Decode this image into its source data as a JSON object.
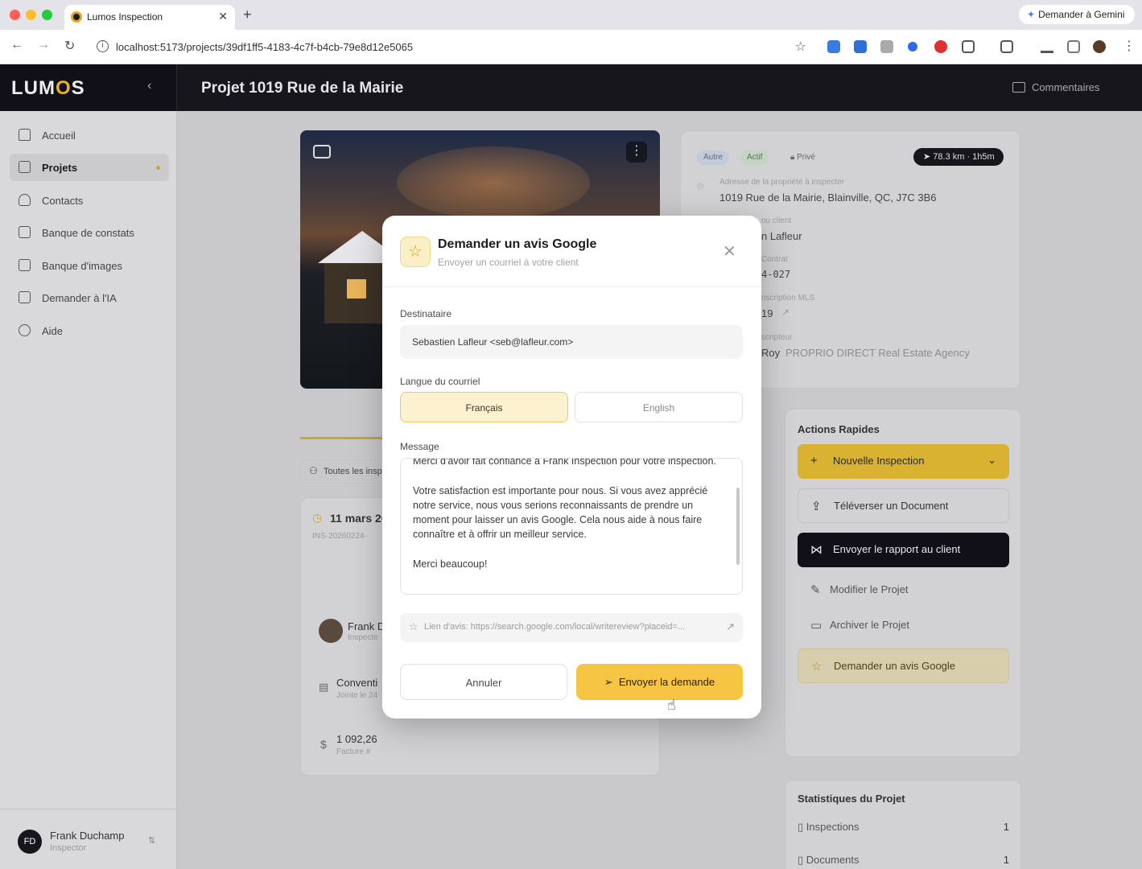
{
  "browser": {
    "tab_title": "Lumos Inspection",
    "url": "localhost:5173/projects/39df1ff5-4183-4c7f-b4cb-79e8d12e5065",
    "gemini_label": "Demander à Gemini"
  },
  "app": {
    "logo": "LUMOS",
    "project_title": "Projet 1019 Rue de la Mairie",
    "comments_label": "Commentaires"
  },
  "sidebar": {
    "items": [
      {
        "label": "Accueil",
        "icon": "home-icon"
      },
      {
        "label": "Projets",
        "icon": "folder-icon",
        "active": true
      },
      {
        "label": "Contacts",
        "icon": "user-icon"
      },
      {
        "label": "Banque de constats",
        "icon": "document-icon"
      },
      {
        "label": "Banque d'images",
        "icon": "image-icon"
      },
      {
        "label": "Demander à l'IA",
        "icon": "chat-icon"
      },
      {
        "label": "Aide",
        "icon": "help-icon"
      }
    ],
    "user": {
      "initials": "FD",
      "name": "Frank Duchamp",
      "role": "Inspector"
    }
  },
  "project_info": {
    "badges": [
      "Autre",
      "Actif",
      "Privé"
    ],
    "distance": "78.3 km · 1h5m",
    "address_label": "Adresse de la propriété à inspecter",
    "address": "1019 Rue de la Mairie, Blainville, QC, J7C 3B6",
    "client_label": "ou client",
    "client": "n Lafleur",
    "contract_label": "Contrat",
    "contract": "4-027",
    "mls_label": "nscription MLS",
    "mls": "19",
    "broker_label": "scripteur",
    "broker_name": "Roy",
    "broker_agency": "PROPRIO DIRECT Real Estate Agency"
  },
  "inspections": {
    "filter": "Toutes les insp",
    "date": "11 mars 20",
    "id": "INS-20260224-",
    "inspector": "Frank D",
    "inspector_role": "Inspecte",
    "doc_title": "Conventi",
    "doc_sub": "Jointe le 24",
    "amount": "1 092,26",
    "amount_sub": "Facture #"
  },
  "quick_actions": {
    "title": "Actions Rapides",
    "items": [
      "Nouvelle Inspection",
      "Téléverser un Document",
      "Envoyer le rapport au client",
      "Modifier le Projet",
      "Archiver le Projet",
      "Demander un avis Google"
    ]
  },
  "stats": {
    "title": "Statistiques du Projet",
    "rows": [
      {
        "label": "Inspections",
        "value": "1"
      },
      {
        "label": "Documents",
        "value": "1"
      }
    ]
  },
  "modal": {
    "title": "Demander un avis Google",
    "subtitle": "Envoyer un courriel à votre client",
    "recipient_label": "Destinataire",
    "recipient": "Sebastien Lafleur <seb@lafleur.com>",
    "language_label": "Langue du courriel",
    "lang_fr": "Français",
    "lang_en": "English",
    "message_label": "Message",
    "message": "Merci d'avoir fait confiance à Frank Inspection pour votre inspection.\n\nVotre satisfaction est importante pour nous. Si vous avez apprécié notre service, nous vous serions reconnaissants de prendre un moment pour laisser un avis Google. Cela nous aide à nous faire connaître et à offrir un meilleur service.\n\nMerci beaucoup!",
    "review_link": "Lien d'avis: https://search.google.com/local/writereview?placeid=...",
    "cancel": "Annuler",
    "send": "Envoyer la demande"
  },
  "colors": {
    "accent": "#f6c544",
    "dark": "#111018",
    "overlay": "rgba(0,0,0,0.18)"
  }
}
